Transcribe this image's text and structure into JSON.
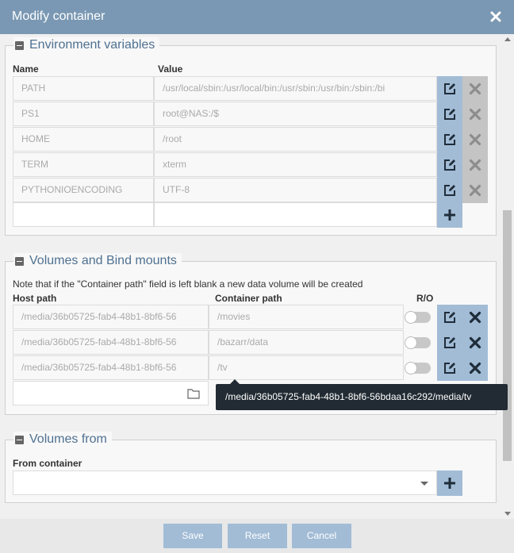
{
  "window": {
    "title": "Modify container"
  },
  "env": {
    "legend": "Environment variables",
    "col_name": "Name",
    "col_value": "Value",
    "rows": [
      {
        "name": "PATH",
        "value": "/usr/local/sbin:/usr/local/bin:/usr/sbin:/usr/bin:/sbin:/bi"
      },
      {
        "name": "PS1",
        "value": "root@NAS:/$"
      },
      {
        "name": "HOME",
        "value": "/root"
      },
      {
        "name": "TERM",
        "value": "xterm"
      },
      {
        "name": "PYTHONIOENCODING",
        "value": "UTF-8"
      }
    ]
  },
  "volumes": {
    "legend": "Volumes and Bind mounts",
    "note": "Note that if the \"Container path\" field is left blank a new data volume will be created",
    "col_host": "Host path",
    "col_container": "Container path",
    "col_ro": "R/O",
    "rows": [
      {
        "host": "/media/36b05725-fab4-48b1-8bf6-56",
        "container": "/movies"
      },
      {
        "host": "/media/36b05725-fab4-48b1-8bf6-56",
        "container": "/bazarr/data"
      },
      {
        "host": "/media/36b05725-fab4-48b1-8bf6-56",
        "container": "/tv"
      }
    ],
    "tooltip": "/media/36b05725-fab4-48b1-8bf6-56bdaa16c292/media/tv"
  },
  "volumes_from": {
    "legend": "Volumes from",
    "col_from": "From container"
  },
  "footer": {
    "save": "Save",
    "reset": "Reset",
    "cancel": "Cancel"
  },
  "icons": {
    "edit": "edit-icon",
    "delete": "delete-icon",
    "add": "plus-icon",
    "folder": "folder-icon",
    "close": "close-icon"
  },
  "colors": {
    "accent": "#7a98b3",
    "button": "#a2bcd6",
    "legend_text": "#4f7191"
  }
}
